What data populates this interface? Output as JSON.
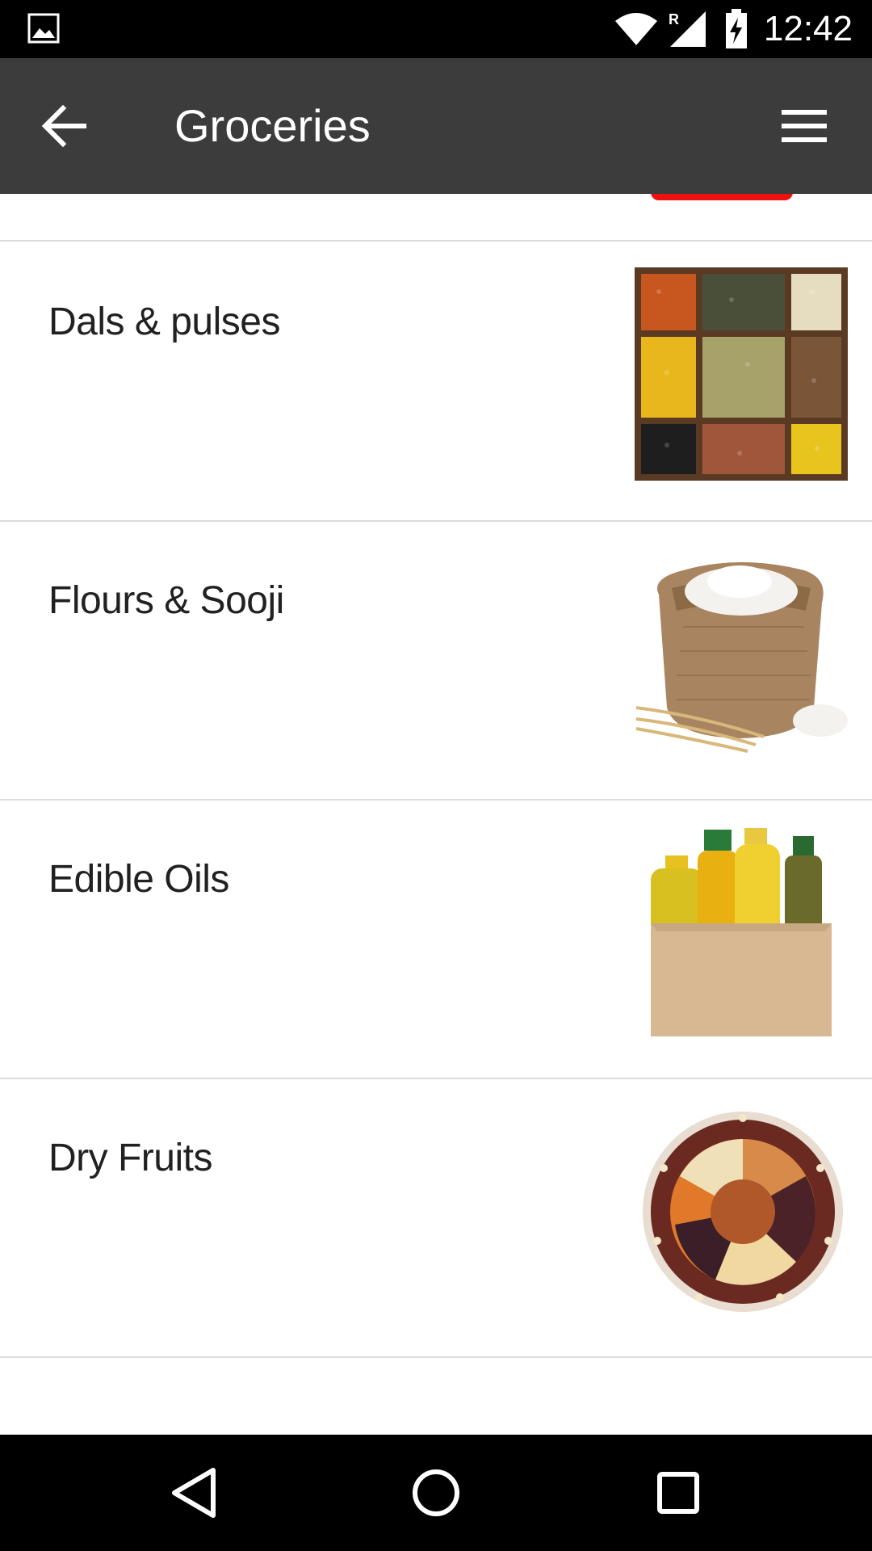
{
  "status_bar": {
    "time": "12:42",
    "network_label": "R",
    "icons": [
      "gallery-icon",
      "wifi-icon",
      "signal-icon",
      "battery-charging-icon"
    ]
  },
  "toolbar": {
    "title": "Groceries",
    "back_icon": "arrow-left-icon",
    "menu_icon": "hamburger-menu-icon"
  },
  "categories": [
    {
      "label": "Dals & pulses",
      "image": "dals-pulses-image"
    },
    {
      "label": "Flours & Sooji",
      "image": "flour-sack-image"
    },
    {
      "label": "Edible Oils",
      "image": "oil-bottles-image"
    },
    {
      "label": "Dry Fruits",
      "image": "dry-fruits-image"
    }
  ],
  "nav_bar": {
    "icons": [
      "back-triangle-icon",
      "home-circle-icon",
      "recents-square-icon"
    ]
  },
  "colors": {
    "toolbar_bg": "#3c3c3c",
    "status_bg": "#000000",
    "divider": "#dcdcdc",
    "text": "#212121",
    "partial_thumb": "#ee1111"
  }
}
